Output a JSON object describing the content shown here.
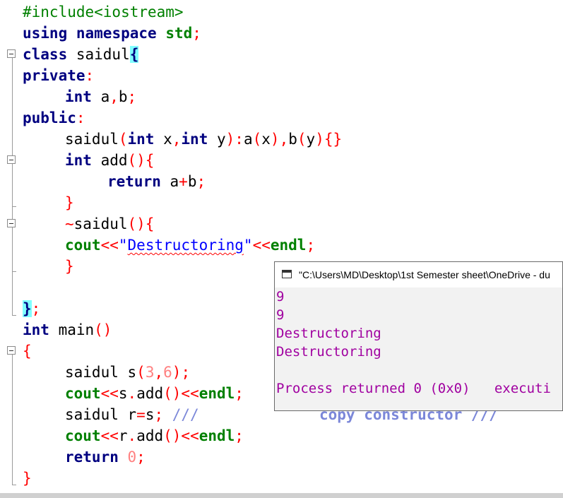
{
  "code": {
    "l1": "#include<iostream>",
    "l2": {
      "k1": "using",
      "k2": "namespace",
      "k3": "std",
      "p": ";"
    },
    "l3": {
      "k": "class",
      "name": " saidul",
      "br": "{"
    },
    "l4": {
      "k": "private",
      "p": ":"
    },
    "l5": {
      "k": "int",
      "rest": " a",
      "c": ",",
      "b": "b",
      "s": ";"
    },
    "l6": {
      "k": "public",
      "p": ":"
    },
    "l7": {
      "name": "saidul",
      "p1": "(",
      "k1": "int",
      "x": " x",
      "c1": ",",
      "k2": "int",
      "y": " y",
      "p2": ")",
      "col": ":",
      "a": "a",
      "p3": "(",
      "ax": "x",
      "p4": ")",
      "c2": ",",
      "b": "b",
      "p5": "(",
      "by": "y",
      "p6": ")",
      "braces": "{}"
    },
    "l8": {
      "k": "int",
      "name": " add",
      "p": "(){"
    },
    "l9": {
      "k": "return",
      "a": " a",
      "plus": "+",
      "b": "b",
      "s": ";"
    },
    "l10": "}",
    "l11": {
      "tilde": "~",
      "name": "saidul",
      "p": "(){"
    },
    "l12": {
      "cout": "cout",
      "op1": "<<",
      "q1": "\"",
      "str": "Destructoring",
      "q2": "\"",
      "op2": "<<",
      "endl": "endl",
      "s": ";"
    },
    "l13": "}",
    "l15": {
      "br": "}",
      "s": ";"
    },
    "l16": {
      "k": "int",
      "name": " main",
      "p": "()"
    },
    "l17": "{",
    "l18": {
      "name": "saidul s",
      "p1": "(",
      "n1": "3",
      "c": ",",
      "n2": "6",
      "p2": ")",
      "s": ";"
    },
    "l19": {
      "cout": "cout",
      "op1": "<<",
      "s": "s",
      "dot": ".",
      "add": "add",
      "p": "()",
      "op2": "<<",
      "endl": "endl",
      "sc": ";"
    },
    "l20": {
      "name": "saidul r",
      "eq": "=",
      "s": "s",
      "sc": ";",
      "cm1": " ///",
      "cm2": "copy constructor ///"
    },
    "l21": {
      "cout": "cout",
      "op1": "<<",
      "r": "r",
      "dot": ".",
      "add": "add",
      "p": "()",
      "op2": "<<",
      "endl": "endl",
      "sc": ";"
    },
    "l22": {
      "k": "return",
      "n": " 0",
      "s": ";"
    },
    "l23": "}"
  },
  "console": {
    "title": "\"C:\\Users\\MD\\Desktop\\1st Semester sheet\\OneDrive - du",
    "lines": [
      "9",
      "9",
      "Destructoring",
      "Destructoring",
      "",
      "Process returned 0 (0x0)   executi"
    ]
  }
}
